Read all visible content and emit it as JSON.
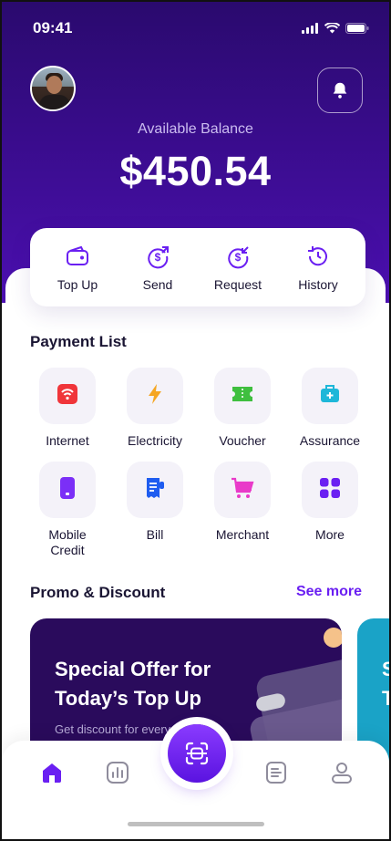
{
  "status": {
    "time": "09:41"
  },
  "balance": {
    "label": "Available Balance",
    "value": "$450.54"
  },
  "actions": [
    {
      "label": "Top Up",
      "icon": "wallet-icon"
    },
    {
      "label": "Send",
      "icon": "send-money-icon"
    },
    {
      "label": "Request",
      "icon": "request-money-icon"
    },
    {
      "label": "History",
      "icon": "history-icon"
    }
  ],
  "payment": {
    "title": "Payment List",
    "items": [
      {
        "label": "Internet",
        "icon": "wifi-icon",
        "color": "#f0353a"
      },
      {
        "label": "Electricity",
        "icon": "lightning-icon",
        "color": "#f5a623"
      },
      {
        "label": "Voucher",
        "icon": "voucher-icon",
        "color": "#3fbf3f"
      },
      {
        "label": "Assurance",
        "icon": "medical-bag-icon",
        "color": "#1eb7d9"
      },
      {
        "label": "Mobile\nCredit",
        "icon": "phone-icon",
        "color": "#7b2ff7"
      },
      {
        "label": "Bill",
        "icon": "receipt-icon",
        "color": "#1e5cf0"
      },
      {
        "label": "Merchant",
        "icon": "cart-icon",
        "color": "#e93ac9"
      },
      {
        "label": "More",
        "icon": "grid-icon",
        "color": "#6a1ff2"
      }
    ]
  },
  "promo": {
    "title": "Promo & Discount",
    "see_more": "See more",
    "card_title": "Special Offer for\nToday’s Top Up",
    "card_subtitle": "Get discount for every top up",
    "card2_title": "S\nT"
  },
  "colors": {
    "accent": "#6a1ff2",
    "hero": "#3a0c8f"
  }
}
